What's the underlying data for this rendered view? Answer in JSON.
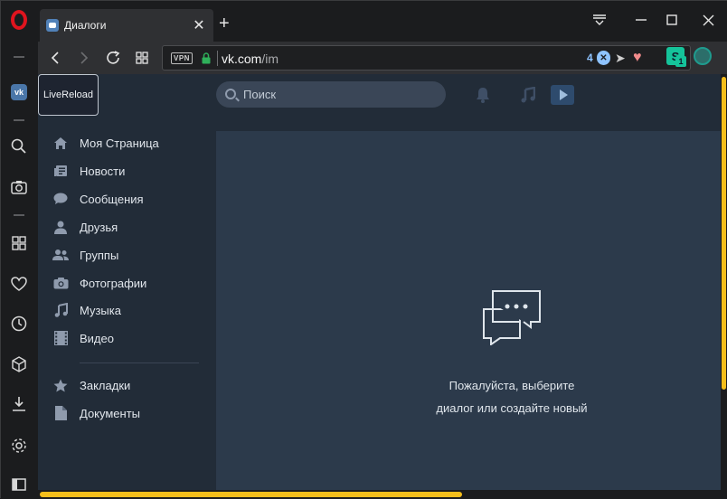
{
  "browser": {
    "tab": {
      "title": "Диалоги",
      "close": "✕"
    },
    "new_tab": "+",
    "address": {
      "vpn": "VPN",
      "domain": "vk.com",
      "path": "/im",
      "blocked_count": "4"
    },
    "extension_badge": "1",
    "accent_color": "#f5be1b"
  },
  "vk": {
    "livereload": "LiveReload",
    "search_placeholder": "Поиск",
    "menu": [
      {
        "label": "Моя Страница",
        "icon": "home-icon"
      },
      {
        "label": "Новости",
        "icon": "news-icon"
      },
      {
        "label": "Сообщения",
        "icon": "messages-icon"
      },
      {
        "label": "Друзья",
        "icon": "friend-icon"
      },
      {
        "label": "Группы",
        "icon": "groups-icon"
      },
      {
        "label": "Фотографии",
        "icon": "camera-icon"
      },
      {
        "label": "Музыка",
        "icon": "music-icon"
      },
      {
        "label": "Видео",
        "icon": "film-icon"
      },
      {
        "label": "Закладки",
        "icon": "star-icon"
      },
      {
        "label": "Документы",
        "icon": "document-icon"
      }
    ],
    "empty_state": {
      "line1": "Пожалуйста, выберите",
      "line2": "диалог или создайте новый"
    }
  }
}
